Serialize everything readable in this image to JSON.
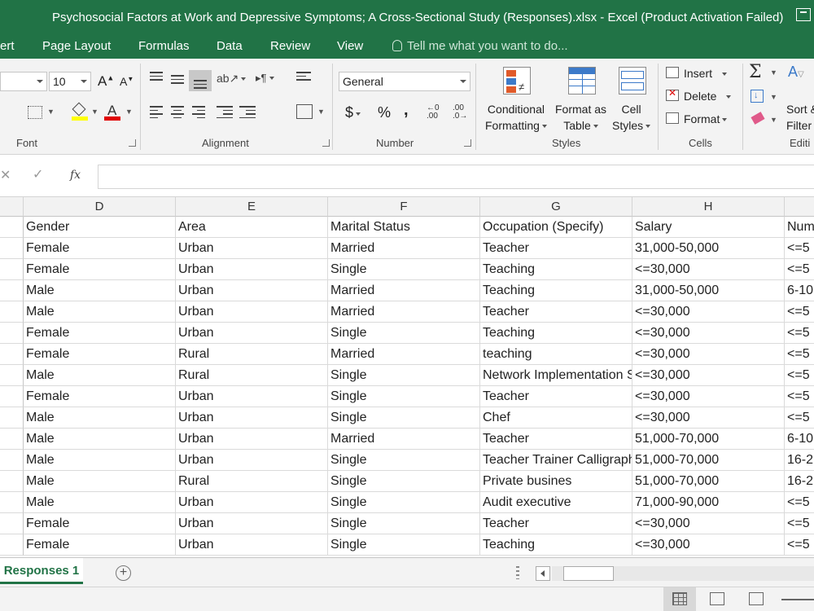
{
  "window": {
    "title": "Psychosocial Factors at Work and Depressive Symptoms; A Cross-Sectional Study (Responses).xlsx - Excel (Product Activation Failed)"
  },
  "ribbon_tabs": [
    "ert",
    "Page Layout",
    "Formulas",
    "Data",
    "Review",
    "View"
  ],
  "tell_me": "Tell me what you want to do...",
  "font_group": {
    "size": "10",
    "grow_label": "A",
    "shrink_label": "A",
    "label": "Font"
  },
  "alignment_group": {
    "label": "Alignment"
  },
  "number_group": {
    "format": "General",
    "currency": "$",
    "percent": "%",
    "comma": ",",
    "inc_decimal": ".00",
    "dec_decimal": ".0",
    "label": "Number"
  },
  "styles_group": {
    "conditional_1": "Conditional",
    "conditional_2": "Formatting",
    "format_table_1": "Format as",
    "format_table_2": "Table",
    "cell_styles_1": "Cell",
    "cell_styles_2": "Styles",
    "label": "Styles"
  },
  "cells_group": {
    "insert": "Insert",
    "delete": "Delete",
    "format": "Format",
    "label": "Cells"
  },
  "editing_group": {
    "sort_1": "Sort &",
    "sort_2": "Filter",
    "label": "Editi"
  },
  "formula_bar": {
    "fx": "fx",
    "cancel": "✕",
    "enter": "✓"
  },
  "columns": [
    "D",
    "E",
    "F",
    "G",
    "H",
    ""
  ],
  "header_row": [
    "Gender",
    "Area",
    "Marital Status",
    "Occupation (Specify)",
    "Salary",
    "Num"
  ],
  "rows": [
    [
      "Female",
      "Urban",
      "Married",
      "Teacher",
      "31,000-50,000",
      "<=5"
    ],
    [
      "Female",
      "Urban",
      "Single",
      "Teaching",
      "<=30,000",
      "<=5"
    ],
    [
      "Male",
      "Urban",
      "Married",
      "Teaching",
      "31,000-50,000",
      "6-10"
    ],
    [
      "Male",
      "Urban",
      "Married",
      "Teacher",
      "<=30,000",
      "<=5"
    ],
    [
      "Female",
      "Urban",
      "Single",
      "Teaching",
      "<=30,000",
      "<=5"
    ],
    [
      "Female",
      "Rural",
      "Married",
      "teaching",
      "<=30,000",
      "<=5"
    ],
    [
      "Male",
      "Rural",
      "Single",
      "Network Implementation S",
      "<=30,000",
      "<=5"
    ],
    [
      "Female",
      "Urban",
      "Single",
      "Teacher",
      "<=30,000",
      "<=5"
    ],
    [
      "Male",
      "Urban",
      "Single",
      "Chef",
      "<=30,000",
      "<=5"
    ],
    [
      "Male",
      "Urban",
      "Married",
      "Teacher",
      "51,000-70,000",
      "6-10"
    ],
    [
      "Male",
      "Urban",
      "Single",
      "Teacher Trainer Calligraph",
      "51,000-70,000",
      "16-2"
    ],
    [
      "Male",
      "Rural",
      "Single",
      "Private busines",
      "51,000-70,000",
      "16-2"
    ],
    [
      "Male",
      "Urban",
      "Single",
      "Audit executive",
      "71,000-90,000",
      "<=5"
    ],
    [
      "Female",
      "Urban",
      "Single",
      "Teacher",
      "<=30,000",
      "<=5"
    ],
    [
      "Female",
      "Urban",
      "Single",
      "Teaching",
      "<=30,000",
      "<=5"
    ]
  ],
  "sheet_tab": "Responses 1",
  "add_sheet": "+",
  "colors": {
    "excel_green": "#217346",
    "ribbon_bg": "#f3f3f3"
  }
}
